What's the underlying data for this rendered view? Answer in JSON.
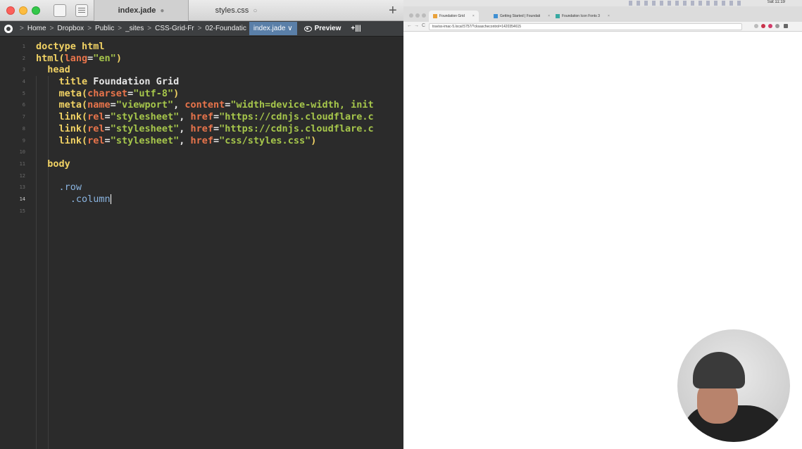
{
  "editor": {
    "tabs": [
      {
        "label": "index.jade",
        "indicator": "●"
      },
      {
        "label": "styles.css",
        "indicator": "○"
      }
    ],
    "new_tab_label": "+",
    "path": [
      "Home",
      "Dropbox",
      "Public",
      "_sites",
      "CSS-Grid-Fr",
      "02-Foundatic"
    ],
    "current_file": "index.jade",
    "current_chevron": "∨",
    "preview_label": "Preview",
    "split_label": "+|||",
    "lines": [
      {
        "num": "1",
        "segments": [
          {
            "t": "doctype html",
            "c": "kw"
          }
        ]
      },
      {
        "num": "2",
        "segments": [
          {
            "t": "html(",
            "c": "kw"
          },
          {
            "t": "lang",
            "c": "at"
          },
          {
            "t": "=",
            "c": "pl"
          },
          {
            "t": "\"en\"",
            "c": "st"
          },
          {
            "t": ")",
            "c": "kw"
          }
        ]
      },
      {
        "num": "3",
        "segments": [
          {
            "t": "  head",
            "c": "kw"
          }
        ]
      },
      {
        "num": "4",
        "segments": [
          {
            "t": "    title ",
            "c": "kw"
          },
          {
            "t": "Foundation Grid",
            "c": "pl"
          }
        ]
      },
      {
        "num": "5",
        "segments": [
          {
            "t": "    meta(",
            "c": "kw"
          },
          {
            "t": "charset",
            "c": "at"
          },
          {
            "t": "=",
            "c": "pl"
          },
          {
            "t": "\"utf-8\"",
            "c": "st"
          },
          {
            "t": ")",
            "c": "kw"
          }
        ]
      },
      {
        "num": "6",
        "segments": [
          {
            "t": "    meta(",
            "c": "kw"
          },
          {
            "t": "name",
            "c": "at"
          },
          {
            "t": "=",
            "c": "pl"
          },
          {
            "t": "\"viewport\"",
            "c": "st"
          },
          {
            "t": ", ",
            "c": "pl"
          },
          {
            "t": "content",
            "c": "at"
          },
          {
            "t": "=",
            "c": "pl"
          },
          {
            "t": "\"width=device-width, init",
            "c": "st"
          }
        ]
      },
      {
        "num": "7",
        "segments": [
          {
            "t": "    link(",
            "c": "kw"
          },
          {
            "t": "rel",
            "c": "at"
          },
          {
            "t": "=",
            "c": "pl"
          },
          {
            "t": "\"stylesheet\"",
            "c": "st"
          },
          {
            "t": ", ",
            "c": "pl"
          },
          {
            "t": "href",
            "c": "at"
          },
          {
            "t": "=",
            "c": "pl"
          },
          {
            "t": "\"https://cdnjs.cloudflare.c",
            "c": "st"
          }
        ]
      },
      {
        "num": "8",
        "segments": [
          {
            "t": "    link(",
            "c": "kw"
          },
          {
            "t": "rel",
            "c": "at"
          },
          {
            "t": "=",
            "c": "pl"
          },
          {
            "t": "\"stylesheet\"",
            "c": "st"
          },
          {
            "t": ", ",
            "c": "pl"
          },
          {
            "t": "href",
            "c": "at"
          },
          {
            "t": "=",
            "c": "pl"
          },
          {
            "t": "\"https://cdnjs.cloudflare.c",
            "c": "st"
          }
        ]
      },
      {
        "num": "9",
        "segments": [
          {
            "t": "    link(",
            "c": "kw"
          },
          {
            "t": "rel",
            "c": "at"
          },
          {
            "t": "=",
            "c": "pl"
          },
          {
            "t": "\"stylesheet\"",
            "c": "st"
          },
          {
            "t": ", ",
            "c": "pl"
          },
          {
            "t": "href",
            "c": "at"
          },
          {
            "t": "=",
            "c": "pl"
          },
          {
            "t": "\"css/styles.css\"",
            "c": "st"
          },
          {
            "t": ")",
            "c": "kw"
          }
        ]
      },
      {
        "num": "10",
        "segments": []
      },
      {
        "num": "11",
        "segments": [
          {
            "t": "  body",
            "c": "kw"
          }
        ]
      },
      {
        "num": "12",
        "segments": []
      },
      {
        "num": "13",
        "segments": [
          {
            "t": "    .row",
            "c": "cls"
          }
        ]
      },
      {
        "num": "14",
        "segments": [
          {
            "t": "      .column",
            "c": "cls"
          }
        ],
        "current": true
      },
      {
        "num": "15",
        "segments": []
      }
    ],
    "colors": {
      "background": "#2b2b2b",
      "keyword": "#f1d264",
      "attribute": "#e8744b",
      "string": "#a6c64b",
      "class": "#8ab4e0"
    }
  },
  "browser": {
    "menubar_time": "Sat 11:19",
    "tabs": [
      {
        "label": "Foundation Grid",
        "icon": "foundation-favicon-icon"
      },
      {
        "label": "Getting Started | Foundati",
        "icon": "foundation-docs-favicon-icon"
      },
      {
        "label": "Foundation Icon Fonts 3",
        "icon": "foundation-icons-favicon-icon"
      }
    ],
    "tab_close": "×",
    "url": "traviss-imac-5.local:5757/?cksaschecontrol=1420354615",
    "nav_back": "←",
    "nav_forward": "→",
    "nav_reload": "C"
  }
}
